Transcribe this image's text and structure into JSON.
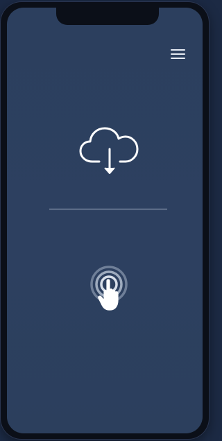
{
  "screen": {
    "menu_icon": "hamburger-menu-icon",
    "primary_icon": "cloud-download-icon",
    "secondary_icon": "touch-tap-icon"
  },
  "colors": {
    "page_background": "#1c2a44",
    "phone_bezel": "#0b0f18",
    "screen_background": "#2c3f5e",
    "icon_stroke": "#ffffff",
    "divider": "#c9d2e0",
    "ring_inner": "#9eabbe",
    "ring_outer": "#6f7f98"
  }
}
